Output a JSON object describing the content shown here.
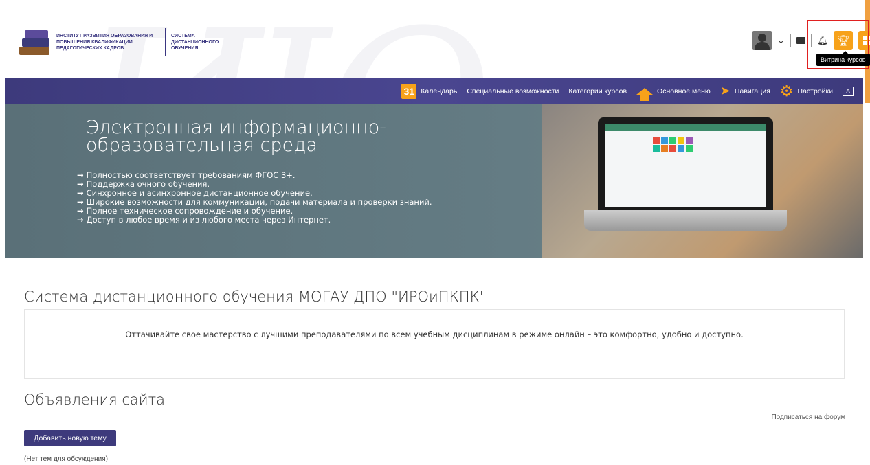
{
  "logo": {
    "institute_name": "Институт развития образования и повышения квалификации педагогических кадров",
    "system_name": "Система дистанционного обучения"
  },
  "user_menu": {
    "tooltip": "Витрина курсов",
    "icons": [
      "avatar",
      "chevron-down-icon",
      "message-icon",
      "bell-icon",
      "trophy-icon",
      "grid-icon"
    ]
  },
  "nav": {
    "calendar_day": "31",
    "items": [
      {
        "label": "Календарь",
        "icon": "calendar-icon"
      },
      {
        "label": "Специальные возможности"
      },
      {
        "label": "Категории курсов"
      },
      {
        "label": "Основное меню",
        "icon": "home-icon"
      },
      {
        "label": "Навигация",
        "icon": "navigation-icon"
      },
      {
        "label": "Настройки",
        "icon": "gear-icon"
      },
      {
        "label": "",
        "icon": "language-icon"
      }
    ]
  },
  "banner": {
    "title_line1": "Электронная информационно-",
    "title_line2": "образовательная среда",
    "bullets": [
      "Полностью соответствует требованиям ФГОС 3+.",
      "Поддержка очного обучения.",
      "Синхронное и асинхронное дистанционное обучение.",
      "Широкие возможности для коммуникации, подачи материала и проверки знаний.",
      "Полное техническое сопровождение и обучение.",
      "Доступ в любое время и из любого места через Интернет."
    ]
  },
  "main": {
    "title": "Система дистанционного обучения МОГАУ ДПО \"ИРОиПКПК\"",
    "welcome": "Оттачивайте свое мастерство с лучшими преподавателями по всем учебным дисциплинам в режиме онлайн  – это комфортно, удобно и доступно."
  },
  "news": {
    "title": "Объявления сайта",
    "subscribe": "Подписаться на форум",
    "add_button": "Добавить новую тему",
    "empty": "(Нет тем для обсуждения)"
  },
  "colors": {
    "brand": "#3d3a7c",
    "accent": "#f7a21a",
    "highlight": "#e02020"
  }
}
